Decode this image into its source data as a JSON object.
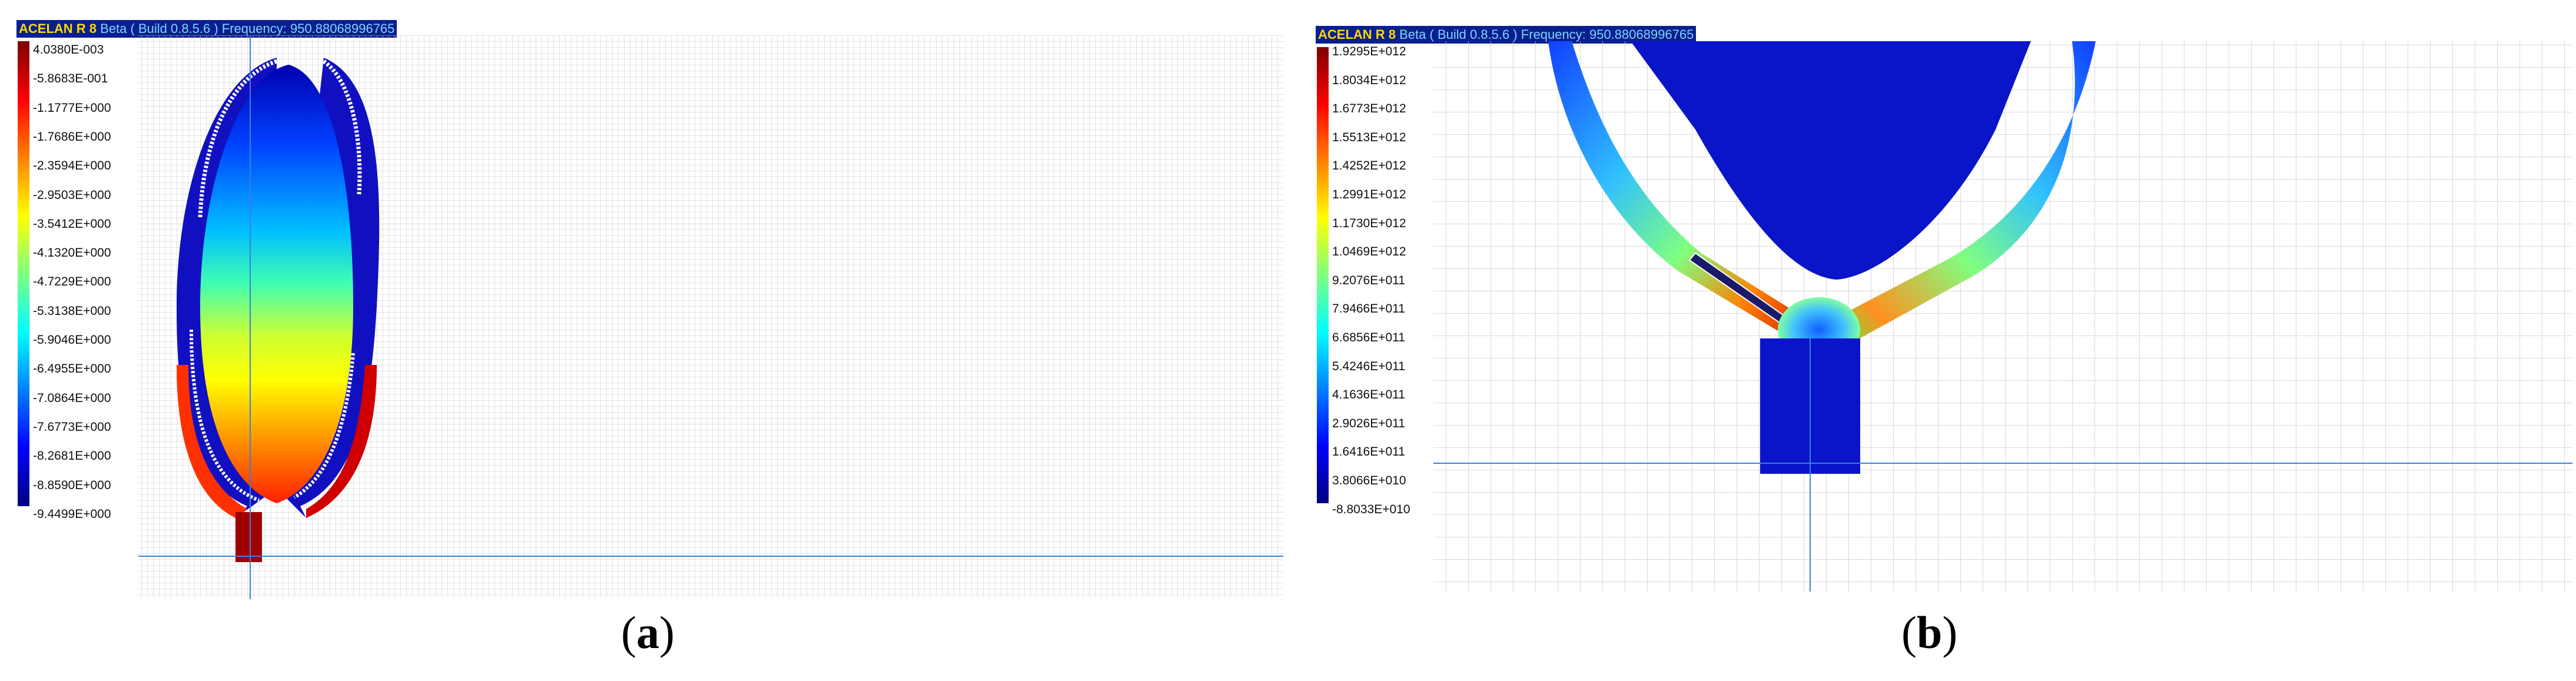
{
  "panel_a": {
    "title": {
      "app": "ACELAN R 8",
      "version": "Beta ( Build 0.8.5.6 ) Frequency: 950.88068996765"
    },
    "colorbar_labels": [
      "4.0380E-003",
      "-5.8683E-001",
      "-1.1777E+000",
      "-1.7686E+000",
      "-2.3594E+000",
      "-2.9503E+000",
      "-3.5412E+000",
      "-4.1320E+000",
      "-4.7229E+000",
      "-5.3138E+000",
      "-5.9046E+000",
      "-6.4955E+000",
      "-7.0864E+000",
      "-7.6773E+000",
      "-8.2681E+000",
      "-8.8590E+000",
      "-9.4499E+000"
    ],
    "caption_open": "(",
    "caption_letter": "a",
    "caption_close": ")"
  },
  "panel_b": {
    "title": {
      "app": "ACELAN R 8",
      "version": "Beta ( Build 0.8.5.6 ) Frequency: 950.88068996765"
    },
    "colorbar_labels": [
      "1.9295E+012",
      "1.8034E+012",
      "1.6773E+012",
      "1.5513E+012",
      "1.4252E+012",
      "1.2991E+012",
      "1.1730E+012",
      "1.0469E+012",
      "9.2076E+011",
      "7.9466E+011",
      "6.6856E+011",
      "5.4246E+011",
      "4.1636E+011",
      "2.9026E+011",
      "1.6416E+011",
      "3.8066E+010",
      "-8.8033E+010"
    ],
    "caption_open": "(",
    "caption_letter": "b",
    "caption_close": ")"
  },
  "colors": {
    "title_bg": "#0a1f8f",
    "app_name": "#ffd700",
    "version_text": "#7fd3ff",
    "crosshair": "#3a7fe0"
  }
}
